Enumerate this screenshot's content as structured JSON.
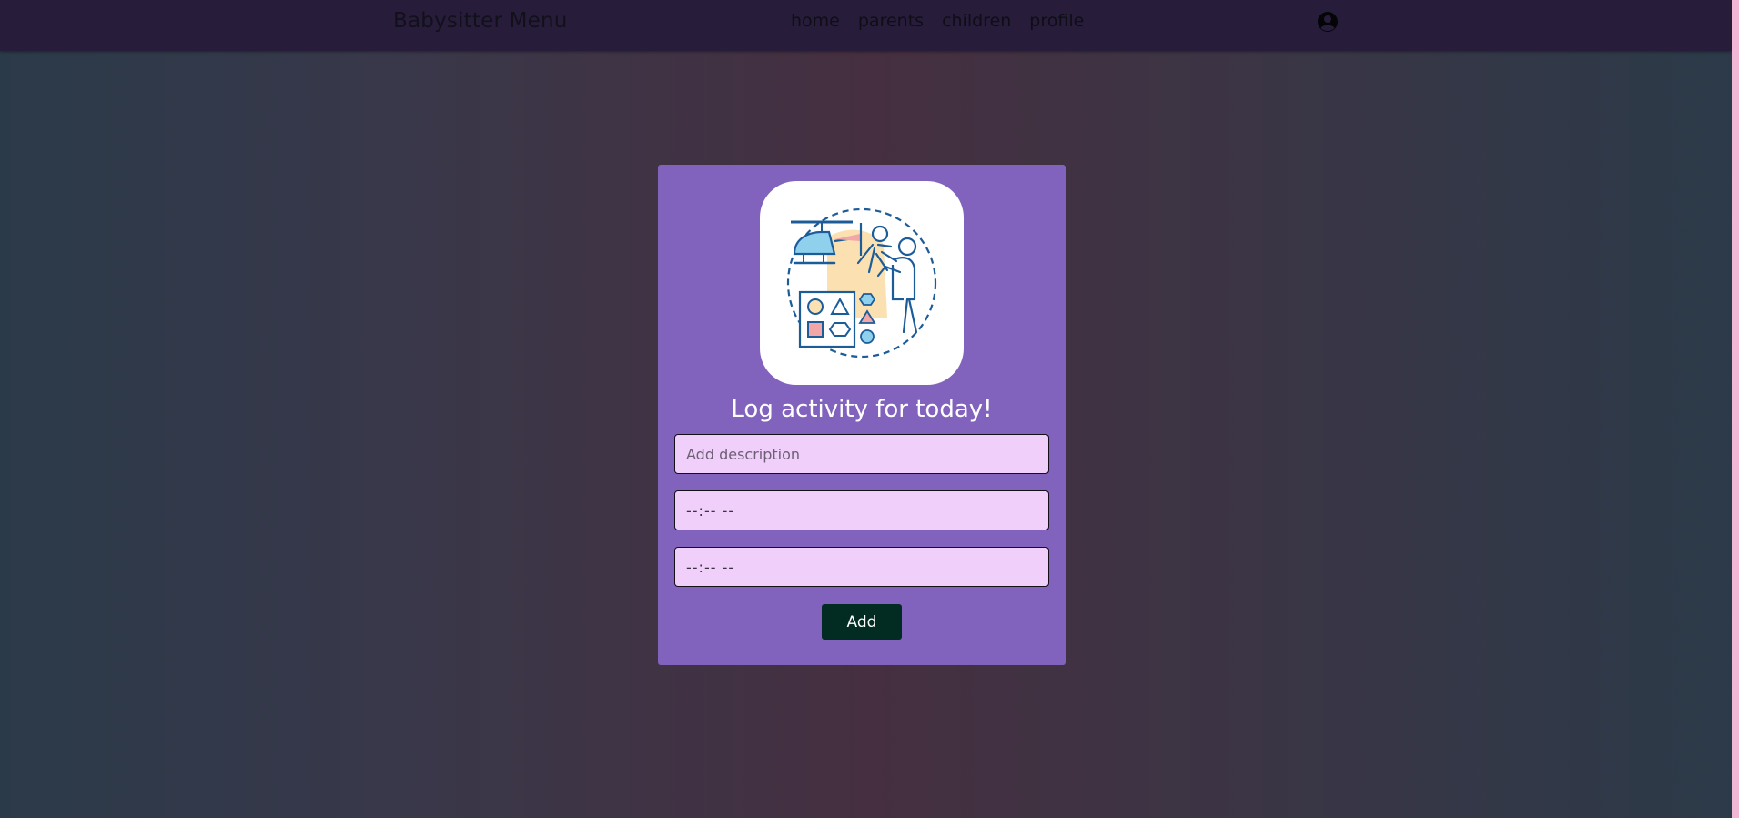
{
  "navbar": {
    "brand": "Babysitter Menu",
    "links": [
      {
        "label": "home"
      },
      {
        "label": "parents"
      },
      {
        "label": "children"
      },
      {
        "label": "profile"
      }
    ],
    "profile_icon": "user-circle-icon"
  },
  "card": {
    "illustration": "babysitter-playing-icon",
    "title": "Log activity for today!",
    "description_placeholder": "Add description",
    "start_time_value": "--:-- --",
    "end_time_value": "--:-- --",
    "add_label": "Add"
  },
  "colors": {
    "navbar_bg": "#271d3b",
    "card_bg": "#8163bd",
    "field_bg": "#f0d0fa",
    "button_bg": "#022b22",
    "accent_pink": "#f2b7d4"
  }
}
